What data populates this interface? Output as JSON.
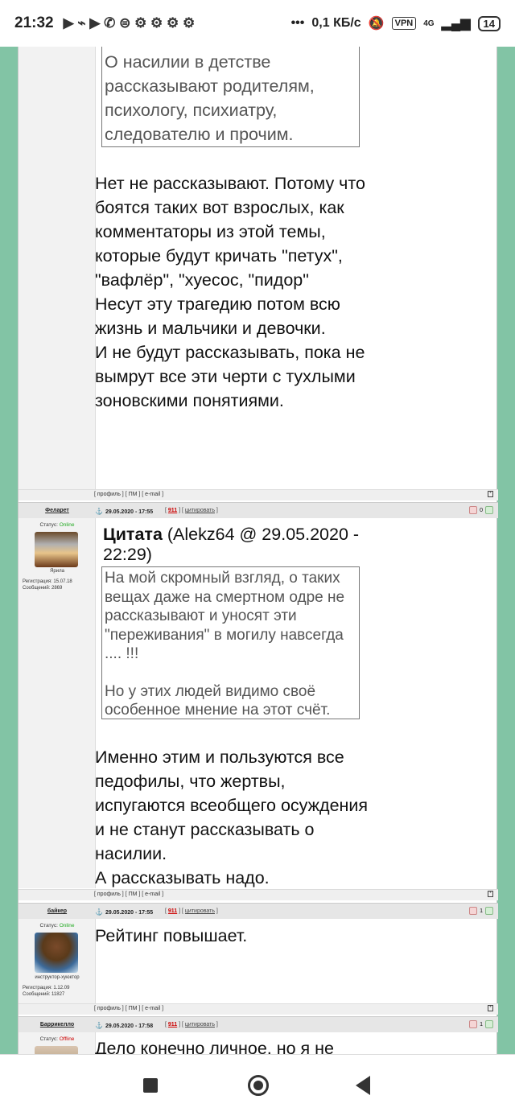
{
  "statusbar": {
    "time": "21:32",
    "icons": "▶ ⌁ ▶ ✆ ⊜ ⚙ ⚙ ⚙ ⚙",
    "speed": "0,1 КБ/с",
    "vpn": "VPN",
    "net": "4G",
    "battery": "14"
  },
  "post1": {
    "quote_lines": "О насилии в детстве рассказывают родителям, психологу, психиатру, следователю и прочим.",
    "text": "Нет не рассказывают. Потому что боятся таких вот взрослых, как комментаторы из этой темы, которые будут кричать \"петух\", \"вафлёр\", \"хуесос, \"пидор\"\nНесут эту трагедию потом всю жизнь и мальчики и девочки.\nИ не будут рассказывать, пока не вымрут все эти черти с тухлыми зоновскими понятиями."
  },
  "footer": {
    "links": "[ профиль ] [ ПМ ] [ e-mail ]",
    "star": "*"
  },
  "post2": {
    "nick": "Феларет",
    "date": "29.05.2020 - 17:55",
    "num": "911",
    "cite": "цитировать",
    "vote_down": "0",
    "status_label": "Статус: ",
    "status": "Online",
    "avatar_caption": "Ярила",
    "reg": "Регистрация: 15.07.18",
    "msgs": "Сообщений: 2869",
    "quote_title_bold": "Цитата",
    "quote_title_rest": " (Alekz64 @ 29.05.2020 - 22:29)",
    "quote_text1": "На мой скромный взгляд, о таких вещах даже на смертном одре не рассказывают и уносят эти \"переживания\" в могилу навсегда .... !!!",
    "quote_text2": "Но у этих людей видимо своё особенное мнение на этот счёт.",
    "text": "Именно этим и пользуются все педофилы, что жертвы, испугаются всеобщего осуждения и не станут рассказывать о насилии.\nА рассказывать надо."
  },
  "post3": {
    "nick": "байкер",
    "date": "29.05.2020 - 17:55",
    "num": "911",
    "cite": "цитировать",
    "vote_down": "1",
    "status_label": "Статус: ",
    "status": "Online",
    "avatar_caption": "инструктор-хуюктор",
    "reg": "Регистрация: 1.12.09",
    "msgs": "Сообщений: 11827",
    "text": "Рейтинг повышает."
  },
  "post4": {
    "nick": "Баррикелло",
    "date": "29.05.2020 - 17:58",
    "num": "911",
    "cite": "цитировать",
    "vote_down": "1",
    "status_label": "Статус: ",
    "status": "Offline",
    "text": "Дело конечно личное, но я не"
  }
}
